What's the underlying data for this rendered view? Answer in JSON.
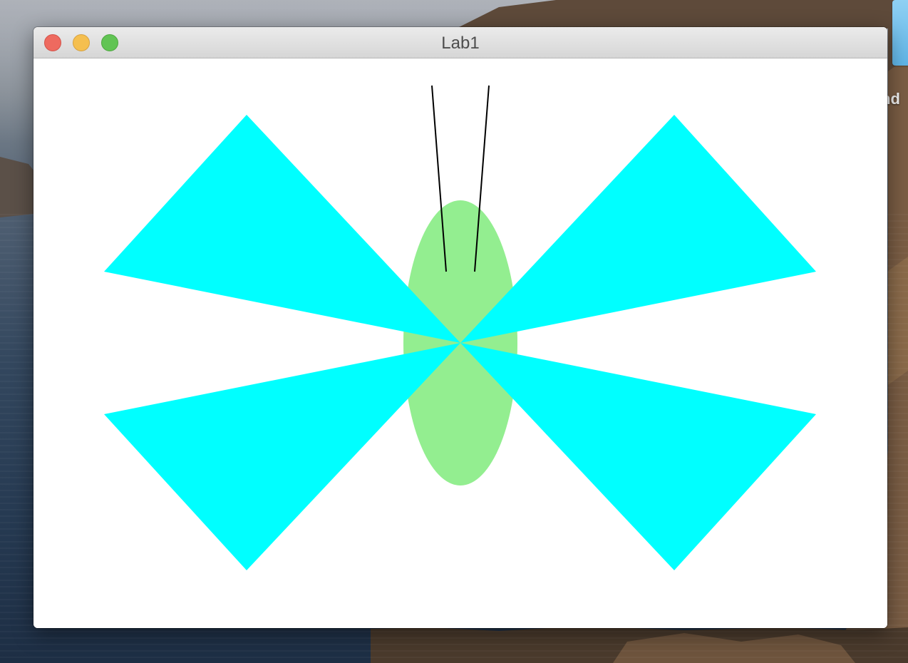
{
  "window": {
    "title": "Lab1"
  },
  "desktop": {
    "folder_label_visible_fragment": "nd"
  },
  "colors": {
    "wing": "#00ffff",
    "body": "#93ee90",
    "antenna": "#000000",
    "canvas_background": "#ffffff",
    "close_button": "#ee6a5f",
    "minimize_button": "#f5bf4f",
    "maximize_button": "#61c454"
  },
  "icons": {
    "close": "traffic-light-close",
    "minimize": "traffic-light-minimize",
    "maximize": "traffic-light-maximize"
  }
}
